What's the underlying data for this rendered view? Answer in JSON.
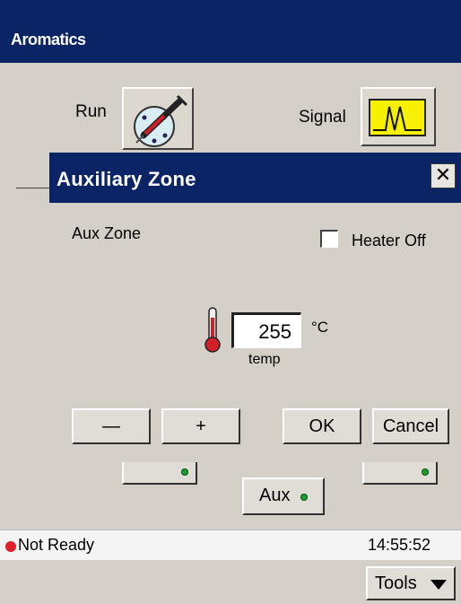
{
  "window": {
    "title": "Aromatics"
  },
  "toolbar": {
    "run_label": "Run",
    "signal_label": "Signal"
  },
  "dialog": {
    "title": "Auxiliary Zone",
    "close_glyph": "✕",
    "zone_label": "Aux Zone",
    "heater_label": "Heater Off",
    "heater_checked": false,
    "temp_value": "255",
    "temp_unit": "°C",
    "temp_caption": "temp",
    "minus_label": "—",
    "plus_label": "+",
    "ok_label": "OK",
    "cancel_label": "Cancel"
  },
  "aux_button": {
    "label": "Aux"
  },
  "status": {
    "text": "Not Ready",
    "time": "14:55:52",
    "indicator_color": "#e0202a"
  },
  "tools_button": {
    "label": "Tools"
  },
  "colors": {
    "titlebar": "#0a2466",
    "led_green": "#1e9b2c",
    "thermo_red": "#d0202a"
  }
}
